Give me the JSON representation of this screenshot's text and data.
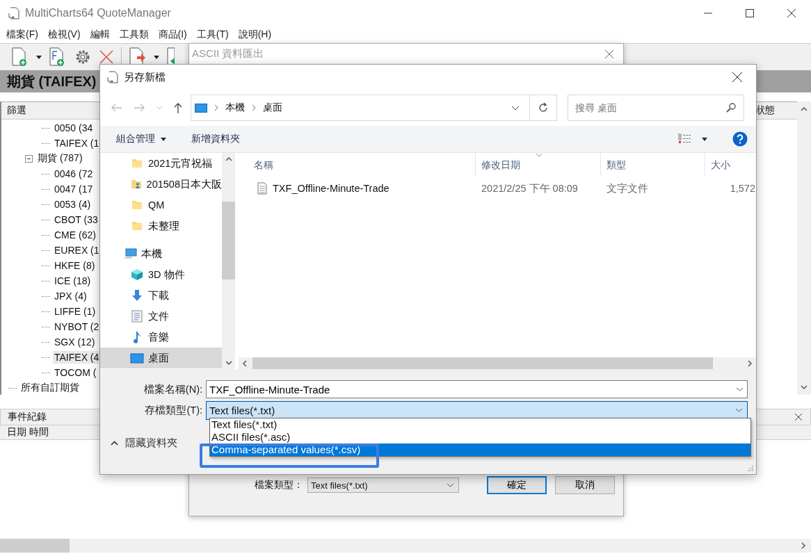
{
  "main_window": {
    "title": "MultiCharts64 QuoteManager",
    "menu": [
      "檔案(F)",
      "檢視(V)",
      "編輯",
      "工具類",
      "商品(I)",
      "工具(T)",
      "說明(H)"
    ],
    "panel_title": "期貨 (TAIFEX)",
    "tree_columns": [
      "篩選",
      "狀態"
    ],
    "tree": [
      {
        "children": [
          {
            "children": [
              {
                "label": "0050 (34",
                "selected": false
              },
              {
                "label": "TAIFEX (1",
                "selected": false
              }
            ]
          },
          {
            "label": "期貨 (787)",
            "selected": false,
            "expanded": true,
            "children": [
              {
                "label": "0046 (72",
                "selected": false
              },
              {
                "label": "0047 (17",
                "selected": false
              },
              {
                "label": "0053 (4)",
                "selected": false
              },
              {
                "label": "CBOT (33",
                "selected": false
              },
              {
                "label": "CME (62)",
                "selected": false
              },
              {
                "label": "EUREX (1",
                "selected": false
              },
              {
                "label": "HKFE (8)",
                "selected": false
              },
              {
                "label": "ICE (18)",
                "selected": false
              },
              {
                "label": "JPX (4)",
                "selected": false
              },
              {
                "label": "LIFFE (1)",
                "selected": false
              },
              {
                "label": "NYBOT (2",
                "selected": false
              },
              {
                "label": "SGX (12)",
                "selected": false
              },
              {
                "label": "TAIFEX (4",
                "selected": true
              },
              {
                "label": "TOCOM (",
                "selected": false
              }
            ]
          }
        ]
      },
      {
        "label": "所有自訂期貨",
        "selected": false
      }
    ],
    "event_log": {
      "title": "事件紀錄",
      "columns": [
        "日期 時間"
      ]
    }
  },
  "export_dialog": {
    "title": "ASCII 資料匯出",
    "file_type_label": "檔案類型：",
    "file_type": "Text files(*.txt)",
    "buttons": [
      {
        "label": "確定",
        "default": true
      },
      {
        "label": "取消",
        "default": false
      }
    ]
  },
  "save_dialog": {
    "title": "另存新檔",
    "path": [
      "本機",
      "桌面"
    ],
    "search": {
      "placeholder": "搜尋 桌面"
    },
    "commands": [
      {
        "label": "組合管理",
        "menu": true
      },
      {
        "label": "新增資料夾",
        "menu": false
      }
    ],
    "nav": [
      {
        "label": "2021元宵祝福",
        "kind": "folder",
        "selected": false
      },
      {
        "label": "201508日本大阪",
        "kind": "shared-folder",
        "selected": false
      },
      {
        "label": "QM",
        "kind": "folder",
        "selected": false
      },
      {
        "label": "未整理",
        "kind": "folder",
        "selected": false
      },
      {
        "label": "本機",
        "kind": "computer",
        "selected": false
      },
      {
        "label": "3D 物件",
        "kind": "cube",
        "selected": false
      },
      {
        "label": "下載",
        "kind": "download",
        "selected": false
      },
      {
        "label": "文件",
        "kind": "document",
        "selected": false
      },
      {
        "label": "音樂",
        "kind": "music",
        "selected": false
      },
      {
        "label": "桌面",
        "kind": "desktop",
        "selected": true
      }
    ],
    "columns": [
      "名稱",
      "修改日期",
      "類型",
      "大小"
    ],
    "files": [
      {
        "name": "TXF_Offline-Minute-Trade",
        "modified": "2021/2/25 下午 08:09",
        "type": "文字文件",
        "size": "1,572"
      }
    ],
    "file_name_label": "檔案名稱(N):",
    "file_name": "TXF_Offline-Minute-Trade",
    "file_type_label": "存檔類型(T):",
    "file_type": "Text files(*.txt)",
    "file_type_options": [
      {
        "label": "Text files(*.txt)",
        "selected": false
      },
      {
        "label": "ASCII files(*.asc)",
        "selected": false
      },
      {
        "label": "Comma-separated values(*.csv)",
        "selected": true
      }
    ],
    "hide_folders": "隱藏資料夾"
  }
}
